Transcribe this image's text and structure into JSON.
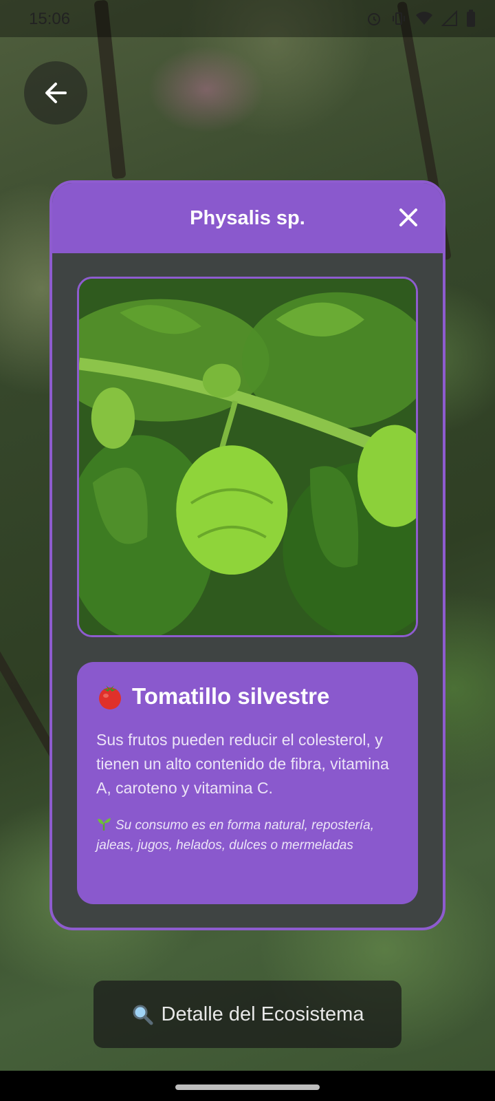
{
  "status_bar": {
    "time": "15:06",
    "icons": [
      "alarm-icon",
      "vibrate-icon",
      "wifi-icon",
      "signal-icon",
      "battery-icon"
    ]
  },
  "back_button": {
    "icon": "arrow-left-icon"
  },
  "modal": {
    "title": "Physalis sp.",
    "close_icon": "close-icon",
    "accent_color": "#8a59cd",
    "card": {
      "emoji": "🍅",
      "title": "Tomatillo silvestre",
      "description": "Sus frutos pueden reducir el colesterol, y tienen un alto contenido de fibra, vitamina A, caroteno y vitamina C.",
      "note_emoji": "🌱",
      "note": "Su consumo es en forma natural, repostería, jaleas, jugos, helados, dulces o mermeladas"
    }
  },
  "detail_button": {
    "icon": "search-icon",
    "label": "Detalle del Ecosistema"
  }
}
